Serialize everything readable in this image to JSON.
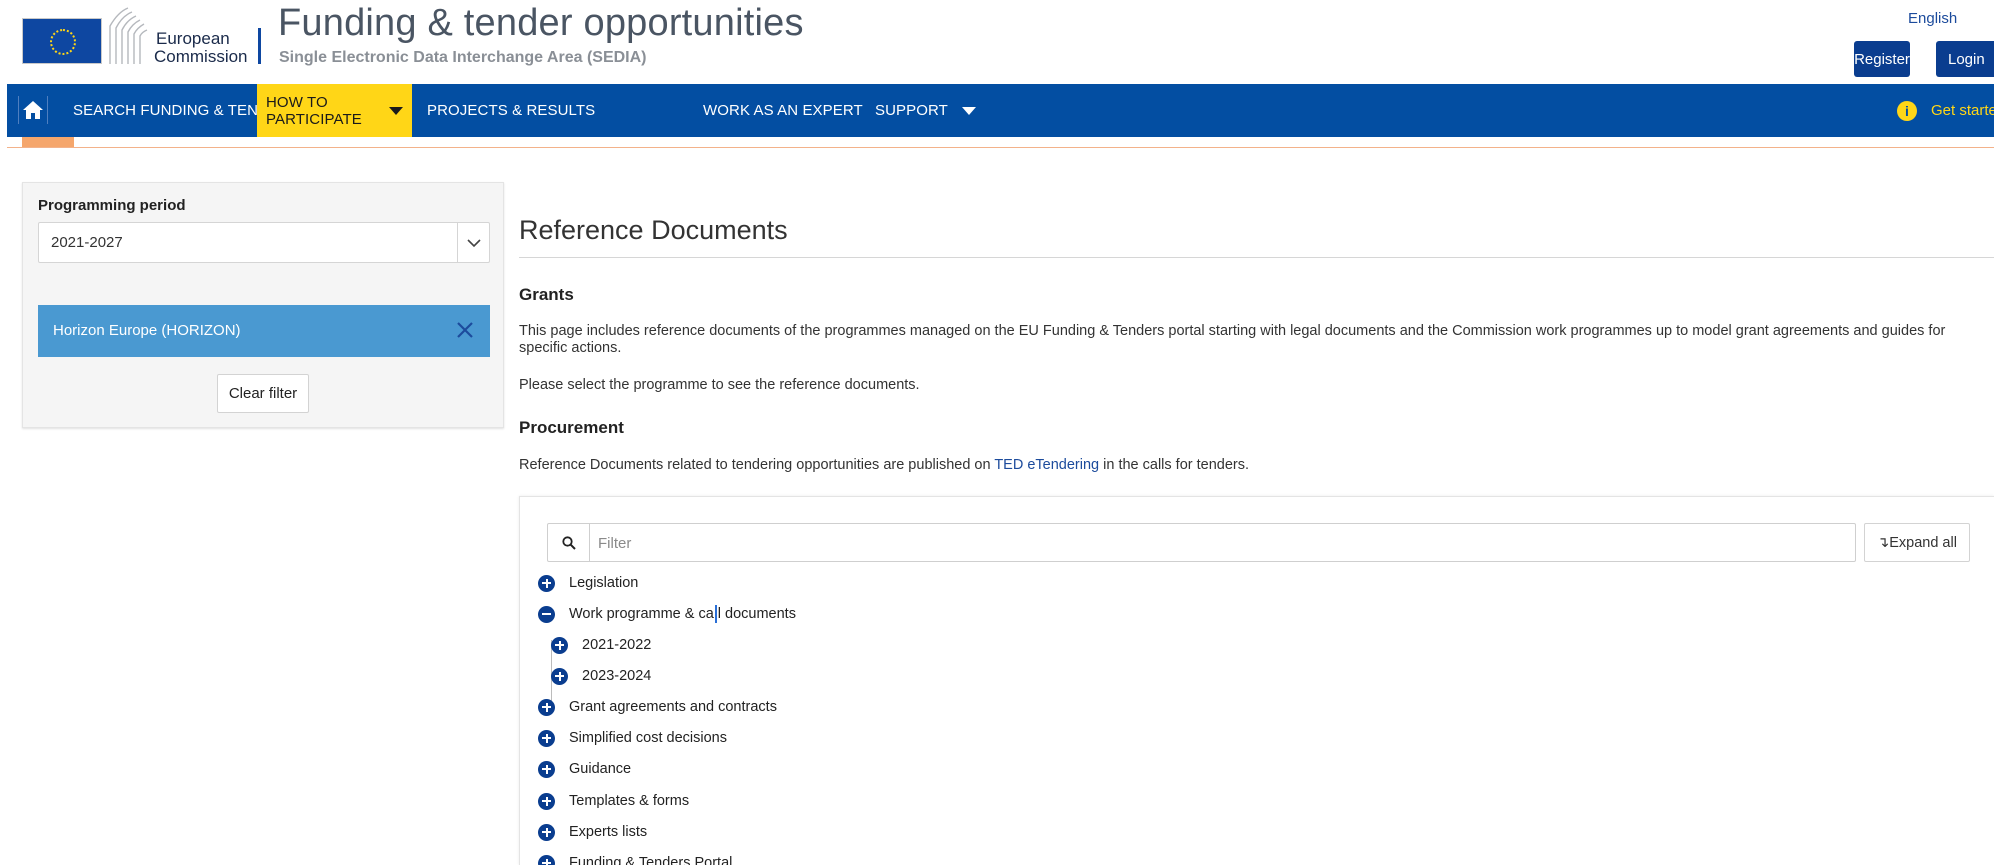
{
  "header": {
    "logo_line1": "European",
    "logo_line2": "Commission",
    "title": "Funding & tender opportunities",
    "subtitle": "Single Electronic Data Interchange Area (SEDIA)",
    "language": "English",
    "register_label": "Register",
    "login_label": "Login"
  },
  "nav": {
    "items": [
      {
        "label": "SEARCH FUNDING & TENDERS"
      },
      {
        "label": "HOW TO PARTICIPATE"
      },
      {
        "label": "PROJECTS & RESULTS"
      },
      {
        "label": "WORK AS AN EXPERT"
      },
      {
        "label": "SUPPORT"
      }
    ],
    "get_started": "Get started",
    "colors": {
      "bar": "#034ea2",
      "active": "#ffd617"
    }
  },
  "filter": {
    "period_label": "Programming period",
    "period_value": "2021-2027",
    "chip_label": "Horizon Europe (HORIZON)",
    "clear_label": "Clear filter",
    "chip_color": "#4a99d1"
  },
  "main": {
    "title": "Reference Documents",
    "grants_heading": "Grants",
    "grants_text": "This page includes reference documents of the programmes managed on the EU Funding & Tenders portal starting with legal documents and the Commission work programmes up to model grant agreements and guides for specific actions.",
    "select_text": "Please select the programme to see the reference documents.",
    "procurement_heading": "Procurement",
    "procurement_text_before": "Reference Documents related to tendering opportunities are published on ",
    "procurement_link": "TED eTendering",
    "procurement_text_after": " in the calls for tenders.",
    "search_placeholder": "Filter",
    "expand_all": "↴Expand all"
  },
  "tree": {
    "items": [
      {
        "label": "Legislation",
        "expanded": false
      },
      {
        "label_before": "Work programme & ca",
        "label_after": "l documents",
        "expanded": true
      },
      {
        "label": "2021-2022",
        "expanded": false
      },
      {
        "label": "2023-2024",
        "expanded": false
      },
      {
        "label": "Grant agreements and contracts",
        "expanded": false
      },
      {
        "label": "Simplified cost decisions",
        "expanded": false
      },
      {
        "label": "Guidance",
        "expanded": false
      },
      {
        "label": "Templates & forms",
        "expanded": false
      },
      {
        "label": "Experts lists",
        "expanded": false
      },
      {
        "label": "Funding & Tenders Portal",
        "expanded": false
      }
    ]
  }
}
